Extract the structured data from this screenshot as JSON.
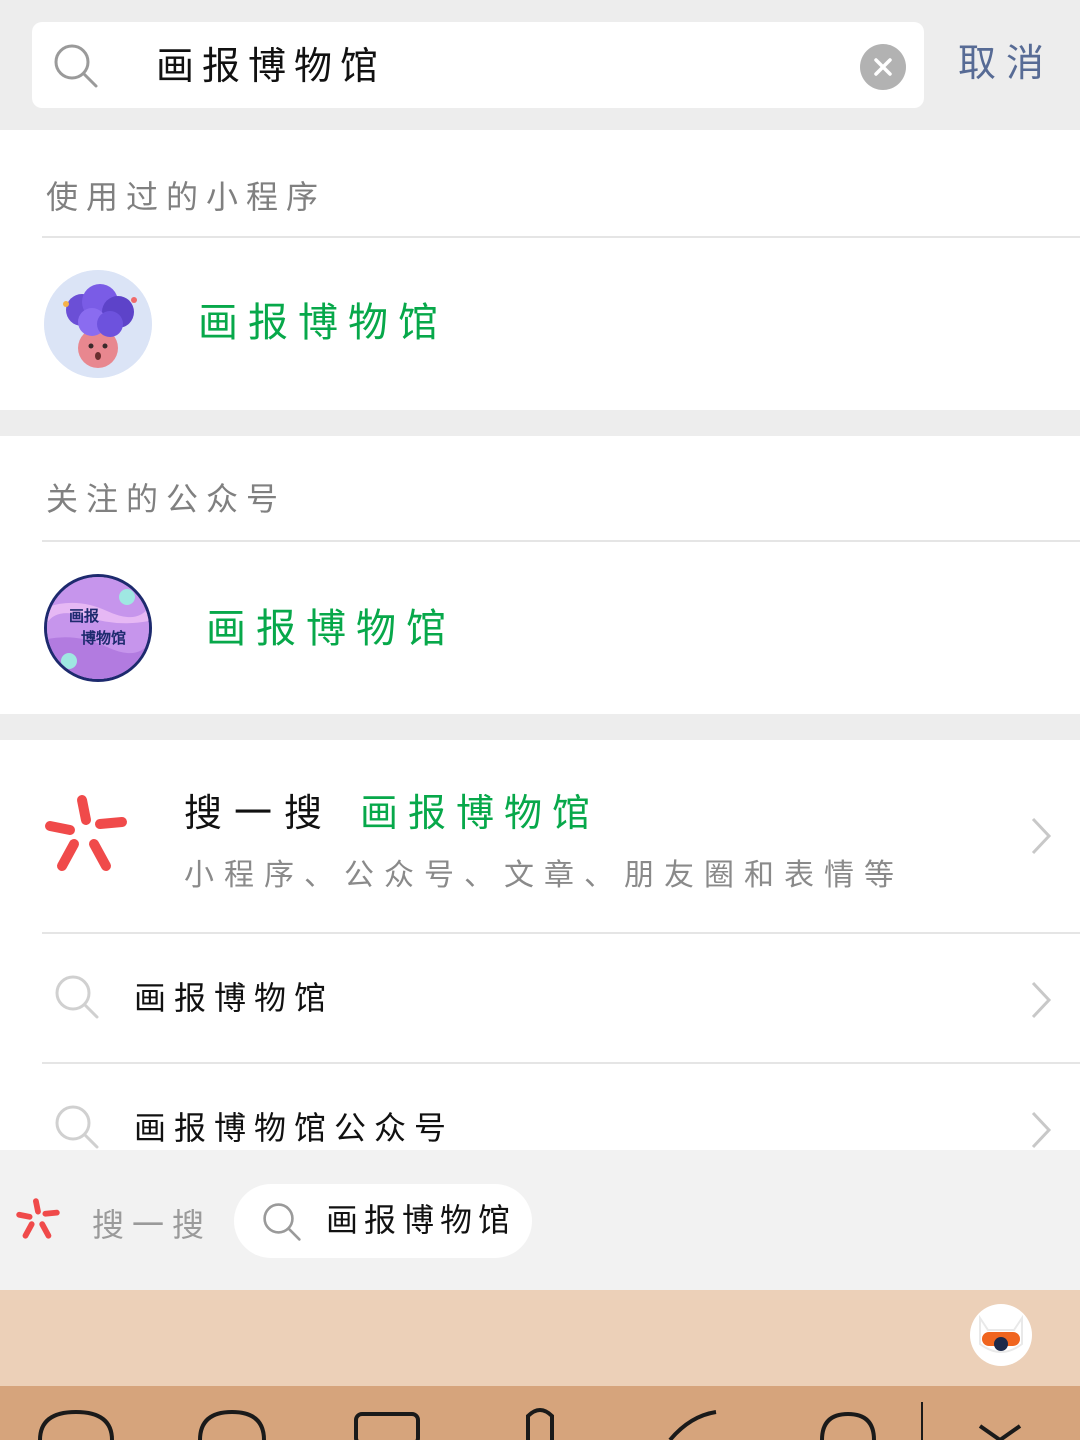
{
  "search": {
    "query": "画报博物馆",
    "cancel_label": "取消"
  },
  "mini_programs": {
    "title": "使用过的小程序",
    "items": [
      {
        "name": "画报博物馆"
      }
    ]
  },
  "official_accounts": {
    "title": "关注的公众号",
    "items": [
      {
        "name": "画报博物馆",
        "avatar_text_1": "画报",
        "avatar_text_2": "博物馆"
      }
    ]
  },
  "sousou": {
    "label": "搜一搜",
    "keyword": "画报博物馆",
    "subtitle": "小程序、公众号、文章、朋友圈和表情等"
  },
  "suggestions": [
    {
      "text": "画报博物馆"
    },
    {
      "text": "画报博物馆公众号"
    }
  ],
  "bottom_bar": {
    "label": "搜一搜",
    "query": "画报博物馆"
  },
  "colors": {
    "accent_green": "#07a84a",
    "link_blue": "#576b95",
    "sousou_red": "#f04a4a"
  },
  "icons": [
    "search-icon",
    "clear-icon",
    "sousou-icon",
    "chevron-right-icon",
    "keyboard-assistant-icon"
  ]
}
